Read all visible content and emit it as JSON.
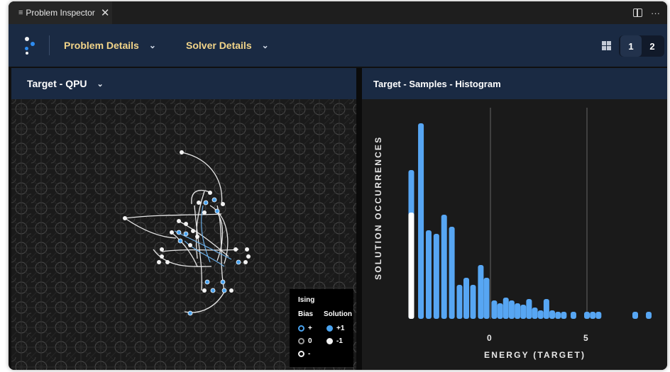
{
  "tab": {
    "title": "Problem Inspector",
    "menu_icon": "menu-icon",
    "close_glyph": "✕"
  },
  "tab_actions": {
    "split_icon": "split-editor-icon",
    "more_glyph": "···"
  },
  "toolbar": {
    "problem_details": "Problem Details",
    "solver_details": "Solver Details",
    "pages": [
      "1",
      "2"
    ],
    "active_page": "1"
  },
  "left_panel": {
    "title": "Target - QPU",
    "legend": {
      "title": "Ising",
      "bias_header": "Bias",
      "solution_header": "Solution",
      "rows": [
        {
          "bias": "+",
          "solution": "+1"
        },
        {
          "bias": "0",
          "solution": "-1"
        },
        {
          "bias": "-",
          "solution": ""
        }
      ]
    }
  },
  "right_panel": {
    "title": "Target - Samples - Histogram"
  },
  "colors": {
    "toolbar_bg": "#1a2a43",
    "accent_text": "#f2d489",
    "bar_blue": "#57a6f3",
    "bar_white": "#ffffff",
    "node_blue": "#4aa3ef",
    "node_white": "#f2f2f2"
  },
  "chart_data": {
    "type": "bar",
    "title": "Target - Samples - Histogram",
    "xlabel": "ENERGY (TARGET)",
    "ylabel": "SOLUTION OCCURRENCES",
    "xlim": [
      -4.3,
      8.3
    ],
    "xticks": [
      0,
      5
    ],
    "grid": "vertical lines at x ticks",
    "series": [
      {
        "color": "#ffffff",
        "points": [
          [
            -4.1,
            150
          ]
        ]
      },
      {
        "color": "#57a6f3",
        "points": [
          [
            -4.1,
            210
          ],
          [
            -3.6,
            276
          ],
          [
            -3.2,
            125
          ],
          [
            -2.8,
            120
          ],
          [
            -2.4,
            147
          ],
          [
            -2.0,
            130
          ],
          [
            -1.6,
            48
          ],
          [
            -1.25,
            58
          ],
          [
            -0.9,
            48
          ],
          [
            -0.5,
            76
          ],
          [
            -0.2,
            58
          ],
          [
            0.2,
            26
          ],
          [
            0.5,
            22
          ],
          [
            0.8,
            30
          ],
          [
            1.1,
            26
          ],
          [
            1.4,
            22
          ],
          [
            1.7,
            20
          ],
          [
            2.0,
            28
          ],
          [
            2.3,
            16
          ],
          [
            2.6,
            12
          ],
          [
            2.9,
            28
          ],
          [
            3.2,
            12
          ],
          [
            3.5,
            10
          ],
          [
            3.8,
            10
          ],
          [
            4.3,
            10
          ],
          [
            5.0,
            10
          ],
          [
            5.3,
            10
          ],
          [
            5.6,
            10
          ],
          [
            7.5,
            10
          ],
          [
            8.2,
            10
          ]
        ]
      }
    ]
  }
}
